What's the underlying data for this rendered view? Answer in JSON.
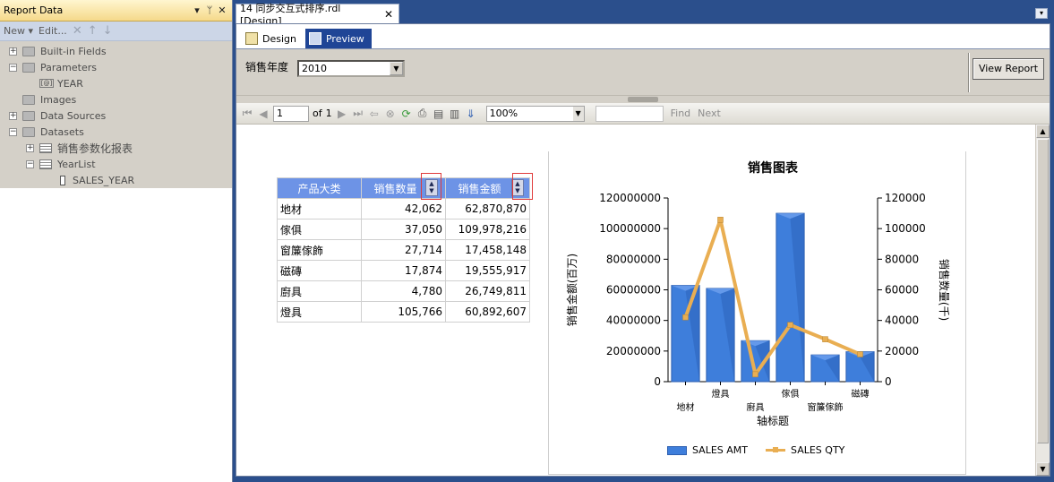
{
  "left_panel": {
    "title": "Report Data",
    "pin_icon": "pin-icon",
    "toolbar": {
      "new_label": "New ▾",
      "edit_label": "Edit..."
    },
    "tree": {
      "built_in_fields": "Built-in Fields",
      "parameters": "Parameters",
      "year_param": "YEAR",
      "images": "Images",
      "data_sources": "Data Sources",
      "datasets": "Datasets",
      "dataset1": "销售参数化报表",
      "dataset2": "YearList",
      "sales_year": "SALES_YEAR"
    }
  },
  "document_tab": {
    "title": "14 同步交互式排序.rdl [Design]"
  },
  "view_tabs": {
    "design": "Design",
    "preview": "Preview"
  },
  "parameters_bar": {
    "label": "销售年度",
    "selected_value": "2010",
    "view_report_label": "View Report"
  },
  "report_toolbar": {
    "page_current": "1",
    "of_label": "of",
    "page_total": "1",
    "zoom": "100%",
    "find_label": "Find",
    "next_label": "Next"
  },
  "table": {
    "headers": [
      "产品大类",
      "销售数量",
      "销售金额"
    ],
    "rows": [
      [
        "地材",
        "42,062",
        "62,870,870"
      ],
      [
        "傢俱",
        "37,050",
        "109,978,216"
      ],
      [
        "窗簾傢飾",
        "27,714",
        "17,458,148"
      ],
      [
        "磁磚",
        "17,874",
        "19,555,917"
      ],
      [
        "廚具",
        "4,780",
        "26,749,811"
      ],
      [
        "燈具",
        "105,766",
        "60,892,607"
      ]
    ]
  },
  "colors": {
    "table_header": "#6d93e6",
    "bar": "#3e7edb",
    "line": "#e9ae52",
    "preview_tab": "#1f4596"
  },
  "chart_data": {
    "type": "bar",
    "title": "销售图表",
    "xlabel": "轴标题",
    "ylabel": "销售金额(百万)",
    "y2label": "销售数量(千)",
    "categories": [
      "地材",
      "燈具",
      "廚具",
      "傢俱",
      "窗簾傢飾",
      "磁磚"
    ],
    "ylim": [
      0,
      120000000
    ],
    "y2lim": [
      0,
      120000
    ],
    "yticks": [
      "0",
      "20000000",
      "40000000",
      "60000000",
      "80000000",
      "100000000",
      "120000000"
    ],
    "y2ticks": [
      "0",
      "20000",
      "40000",
      "60000",
      "80000",
      "100000",
      "120000"
    ],
    "series": [
      {
        "name": "SALES AMT",
        "kind": "bar",
        "axis": "left",
        "values": [
          62870870,
          60892607,
          26749811,
          109978216,
          17458148,
          19555917
        ]
      },
      {
        "name": "SALES QTY",
        "kind": "line",
        "axis": "right",
        "values": [
          42062,
          105766,
          4780,
          37050,
          27714,
          17874
        ]
      }
    ],
    "legend": "bottom",
    "grid": false
  }
}
